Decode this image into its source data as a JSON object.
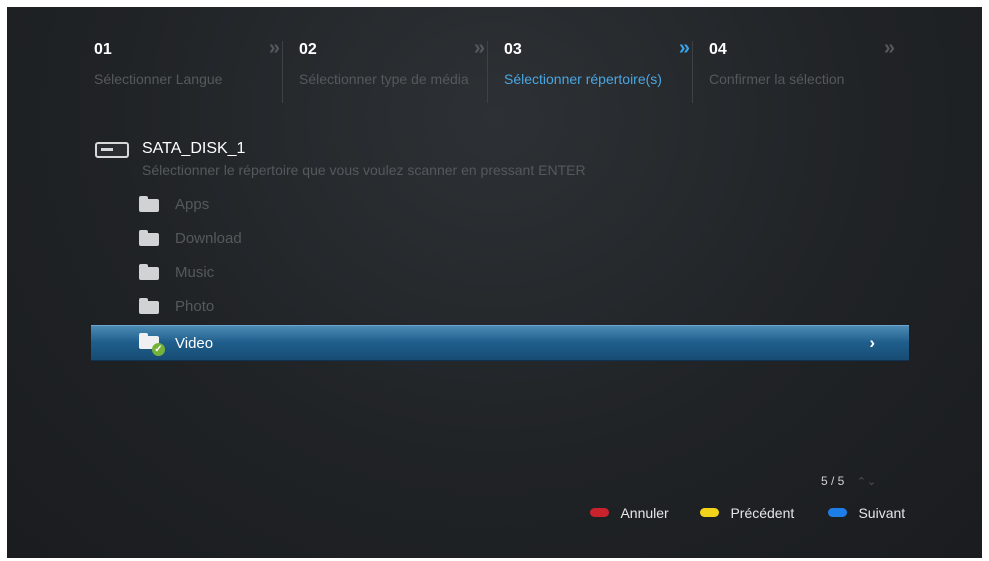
{
  "steps": [
    {
      "num": "01",
      "label": "Sélectionner Langue",
      "chevron": "»"
    },
    {
      "num": "02",
      "label": "Sélectionner type de média",
      "chevron": "»"
    },
    {
      "num": "03",
      "label": "Sélectionner répertoire(s)",
      "chevron": "»",
      "active": true
    },
    {
      "num": "04",
      "label": "Confirmer la sélection",
      "chevron": "»"
    }
  ],
  "drive": {
    "icon": "hard-drive-icon",
    "name": "SATA_DISK_1",
    "hint": "Sélectionner le répertoire que vous voulez scanner en pressant ENTER"
  },
  "folders": [
    {
      "label": "Apps",
      "icon": "folder-icon"
    },
    {
      "label": "Download",
      "icon": "folder-icon"
    },
    {
      "label": "Music",
      "icon": "folder-icon"
    },
    {
      "label": "Photo",
      "icon": "folder-icon"
    },
    {
      "label": "Video",
      "icon": "folder-checked-icon",
      "selected": true,
      "arrow": "›"
    }
  ],
  "pager": {
    "text": "5 / 5",
    "icons": "⌃⌄"
  },
  "legend": {
    "cancel": {
      "label": "Annuler",
      "color": "#c8232c"
    },
    "previous": {
      "label": "Précédent",
      "color": "#f2d21b"
    },
    "next": {
      "label": "Suivant",
      "color": "#1d7ee8"
    }
  },
  "colors": {
    "accent": "#4aa6e1",
    "selection": "#1f5e8c"
  }
}
